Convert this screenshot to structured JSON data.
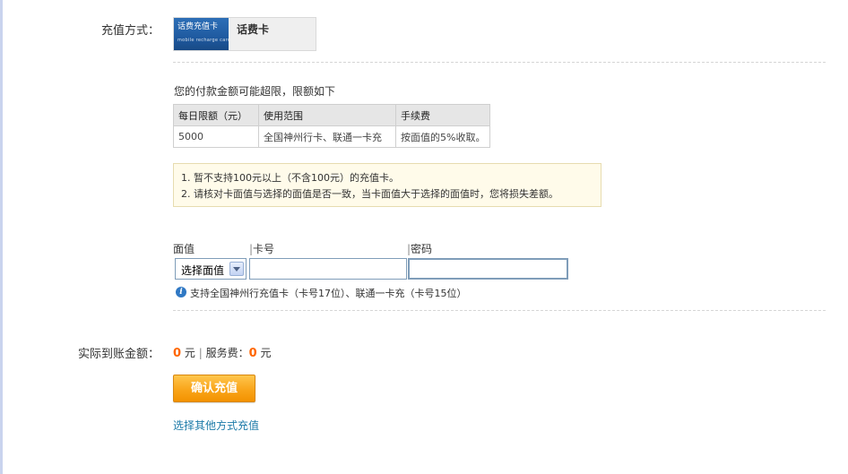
{
  "method": {
    "label": "充值方式：",
    "card_thumb_title": "话费充值卡",
    "card_thumb_sub": "mobile recharge card",
    "name": "话费卡"
  },
  "limits": {
    "title": "您的付款金额可能超限，限额如下",
    "headers": [
      "每日限额（元）",
      "使用范围",
      "手续费"
    ],
    "row": [
      "5000",
      "全国神州行卡、联通一卡充",
      "按面值的5%收取。"
    ]
  },
  "notice": {
    "items": [
      "1.  暂不支持100元以上（不含100元）的充值卡。",
      "2.  请核对卡面值与选择的面值是否一致，当卡面值大于选择的面值时，您将损失差额。"
    ]
  },
  "form": {
    "denomination_label": "面值",
    "card_no_label": "卡号",
    "password_label": "密码",
    "separator": "|",
    "denomination_selected": "选择面值",
    "card_no_value": "",
    "password_value": "",
    "hint": "支持全国神州行充值卡（卡号17位）、联通一卡充（卡号15位）"
  },
  "amount": {
    "label": "实际到账金额：",
    "received": "0",
    "unit": "元",
    "divider": "|",
    "fee_label": "服务费：",
    "fee": "0",
    "fee_unit": "元"
  },
  "actions": {
    "confirm_label": "确认充值",
    "other_link": "选择其他方式充值"
  },
  "colors": {
    "accent_orange": "#ff6600",
    "button_orange": "#f9a51a",
    "link_blue": "#1c7aa8",
    "info_blue": "#2f78c4"
  },
  "icons": {
    "info": "info-icon",
    "dropdown": "chevron-down-icon"
  }
}
